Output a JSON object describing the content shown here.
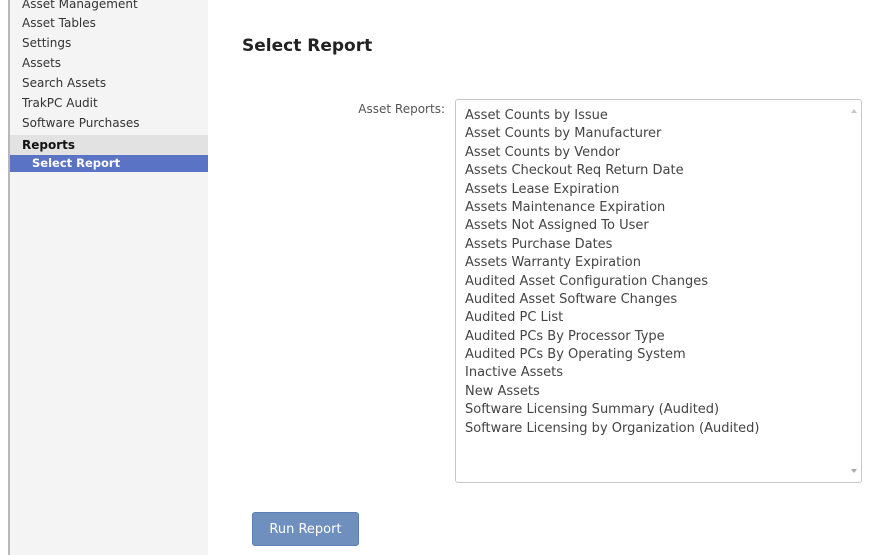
{
  "sidebar": {
    "items": [
      {
        "label": "Asset Management"
      },
      {
        "label": "Asset Tables"
      },
      {
        "label": "Settings"
      },
      {
        "label": "Assets"
      },
      {
        "label": "Search Assets"
      },
      {
        "label": "TrakPC Audit"
      },
      {
        "label": "Software Purchases"
      }
    ],
    "section": {
      "label": "Reports"
    },
    "active_item": {
      "label": "Select Report"
    }
  },
  "main": {
    "title": "Select Report",
    "reports_field": {
      "label": "Asset Reports:",
      "options": [
        "Asset Counts by Issue",
        "Asset Counts by Manufacturer",
        "Asset Counts by Vendor",
        "Assets Checkout Req Return Date",
        "Assets Lease Expiration",
        "Assets Maintenance Expiration",
        "Assets Not Assigned To User",
        "Assets Purchase Dates",
        "Assets Warranty Expiration",
        "Audited Asset Configuration Changes",
        "Audited Asset Software Changes",
        "Audited PC List",
        "Audited PCs By Processor Type",
        "Audited PCs By Operating System",
        "Inactive Assets",
        "New Assets",
        "Software Licensing Summary (Audited)",
        "Software Licensing by Organization (Audited)"
      ]
    },
    "run_button_label": "Run Report"
  },
  "colors": {
    "active_nav_bg": "#5a73c4",
    "section_nav_bg": "#e2e2e2",
    "sidebar_bg": "#f4f4f4",
    "button_bg": "#6f90bf"
  },
  "icons": [
    "scroll-up-arrow-icon",
    "scroll-down-arrow-icon"
  ]
}
